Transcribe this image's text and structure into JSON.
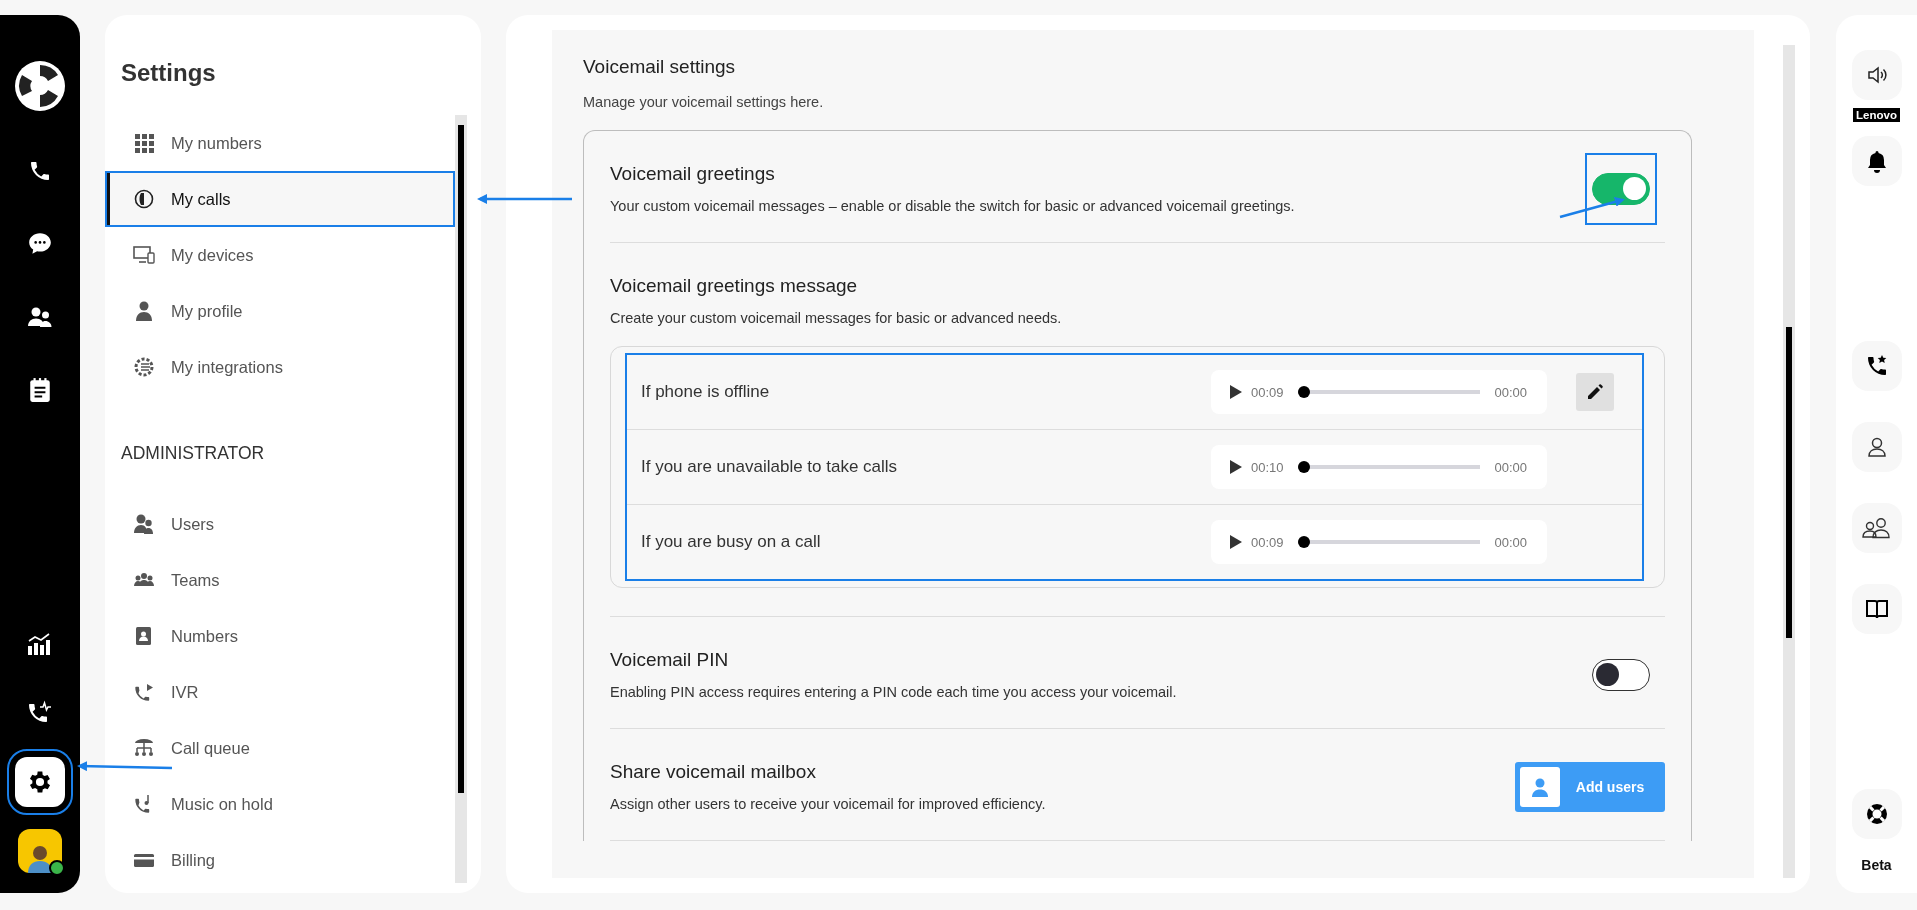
{
  "nav_rail": {
    "items": [
      {
        "kind": "phone",
        "selected": false,
        "highlighted": false
      },
      {
        "kind": "chat",
        "selected": false,
        "highlighted": false
      },
      {
        "kind": "contacts",
        "selected": false,
        "highlighted": false
      },
      {
        "kind": "notes",
        "selected": false,
        "highlighted": false
      },
      {
        "kind": "analytics",
        "selected": false,
        "highlighted": false
      },
      {
        "kind": "call-activity",
        "selected": false,
        "highlighted": false
      },
      {
        "kind": "settings",
        "selected": true,
        "highlighted": true
      }
    ],
    "user": {
      "online": true
    }
  },
  "settings_panel": {
    "title": "Settings",
    "personal_items": [
      {
        "kind": "grid",
        "label": "My numbers",
        "selected": false,
        "highlighted": false
      },
      {
        "kind": "calls",
        "label": "My calls",
        "selected": true,
        "highlighted": true
      },
      {
        "kind": "devices",
        "label": "My devices",
        "selected": false,
        "highlighted": false
      },
      {
        "kind": "profile",
        "label": "My profile",
        "selected": false,
        "highlighted": false
      },
      {
        "kind": "integrations",
        "label": "My integrations",
        "selected": false,
        "highlighted": false
      }
    ],
    "section_heading": "ADMINISTRATOR",
    "admin_items": [
      {
        "kind": "users",
        "label": "Users",
        "selected": false,
        "highlighted": false
      },
      {
        "kind": "teams",
        "label": "Teams",
        "selected": false,
        "highlighted": false
      },
      {
        "kind": "numbers",
        "label": "Numbers",
        "selected": false,
        "highlighted": false
      },
      {
        "kind": "ivr",
        "label": "IVR",
        "selected": false,
        "highlighted": false
      },
      {
        "kind": "queue",
        "label": "Call queue",
        "selected": false,
        "highlighted": false
      },
      {
        "kind": "music",
        "label": "Music on hold",
        "selected": false,
        "highlighted": false
      },
      {
        "kind": "billing",
        "label": "Billing",
        "selected": false,
        "highlighted": false
      }
    ]
  },
  "content": {
    "title": "Voicemail settings",
    "subtitle": "Manage your voicemail settings here.",
    "sections": [
      {
        "kind": "toggle",
        "title": "Voicemail greetings",
        "description": "Your custom voicemail messages – enable or disable the switch for basic or advanced voicemail greetings.",
        "on": true,
        "highlighted": true
      },
      {
        "kind": "greetings",
        "title": "Voicemail greetings message",
        "description": "Create your custom voicemail messages for basic or advanced needs.",
        "highlighted": true,
        "greetings": [
          {
            "label": "If phone is offline",
            "duration": "00:09",
            "position": "00:00",
            "level": 0,
            "editable": true
          },
          {
            "label": "If you are unavailable to take calls",
            "duration": "00:10",
            "position": "00:00",
            "level": 0,
            "editable": false
          },
          {
            "label": "If you are busy on a call",
            "duration": "00:09",
            "position": "00:00",
            "level": 0,
            "editable": false
          }
        ]
      },
      {
        "kind": "toggle",
        "title": "Voicemail PIN",
        "description": "Enabling PIN access requires entering a PIN code each time you access your voicemail.",
        "on": false,
        "highlighted": false
      },
      {
        "kind": "button",
        "title": "Share voicemail mailbox",
        "description": "Assign other users to receive your voicemail for improved efficiency.",
        "button_label": "Add users"
      }
    ]
  },
  "right_rail": {
    "device_label": "Lenovo",
    "top_items": [
      {
        "kind": "speaker"
      },
      {
        "kind": "bell"
      }
    ],
    "middle_items": [
      {
        "kind": "call-star"
      },
      {
        "kind": "person"
      },
      {
        "kind": "group"
      },
      {
        "kind": "book"
      }
    ],
    "bottom_items": [
      {
        "kind": "lifebuoy"
      }
    ],
    "beta_label": "Beta"
  }
}
